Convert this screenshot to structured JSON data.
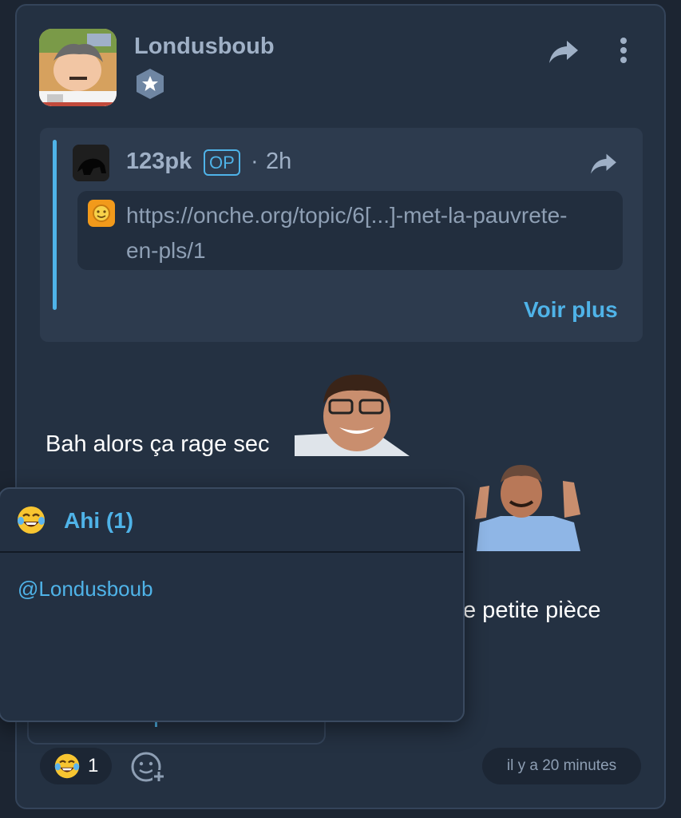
{
  "post": {
    "author": "Londusboub",
    "badge_icon": "star-shield-icon",
    "body_line1": "Bah alors ça rage sec",
    "body_line3": "e petite pièce",
    "timestamp": "il y a 20 minutes"
  },
  "quote": {
    "author": "123pk",
    "op_badge": "OP",
    "separator": "·",
    "time": "2h",
    "link_text": "https://onche.org/topic/6[...]-met-la-pauvrete-en-pls/1",
    "voir_plus": "Voir plus"
  },
  "popup": {
    "title": "Ahi (1)",
    "emoji_icon": "laughing-crying-face-icon",
    "users": [
      "@Londusboub"
    ]
  },
  "reactions": {
    "count": "1",
    "emoji_icon": "laughing-crying-face-icon",
    "add_icon": "add-reaction-icon"
  },
  "colors": {
    "accent": "#4fb3e8",
    "card_bg": "#243142",
    "page_bg": "#1c2532",
    "muted": "#9fb0c6"
  }
}
